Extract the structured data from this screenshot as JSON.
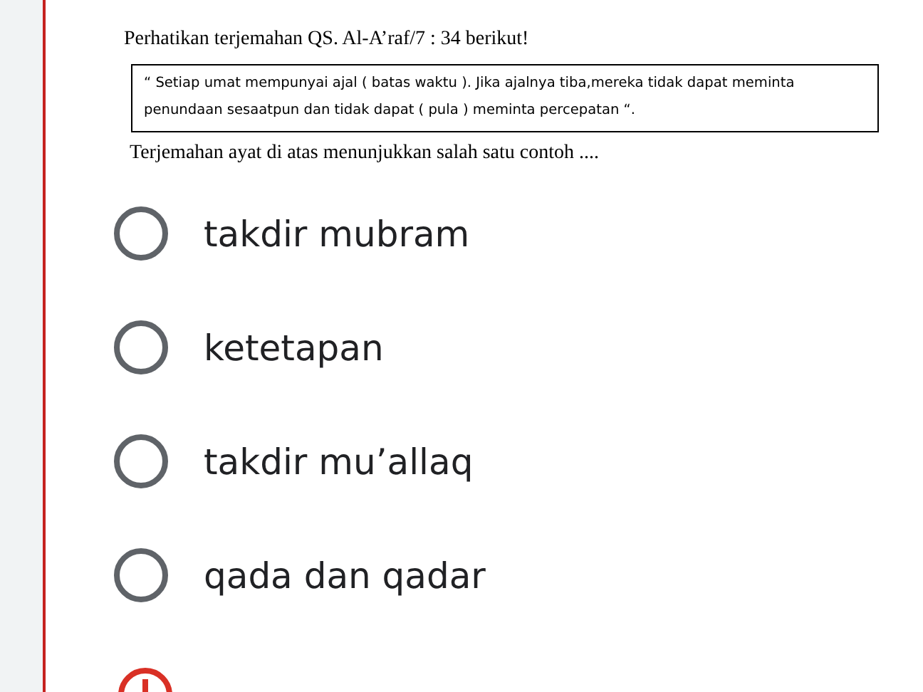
{
  "question": {
    "title": "Perhatikan terjemahan QS. Al-A’raf/7 : 34 berikut!",
    "quote": "“ Setiap umat mempunyai  ajal ( batas waktu ). Jika ajalnya tiba,mereka tidak dapat meminta penundaan sesaatpun dan tidak dapat ( pula ) meminta percepatan “.",
    "prompt": "Terjemahan ayat di atas menunjukkan salah satu contoh ...."
  },
  "options": [
    {
      "label": "takdir mubram",
      "selected": false
    },
    {
      "label": "ketetapan",
      "selected": false
    },
    {
      "label": "takdir mu’allaq",
      "selected": false
    },
    {
      "label": "qada dan qadar",
      "selected": false
    }
  ],
  "error": {
    "shown": true
  }
}
